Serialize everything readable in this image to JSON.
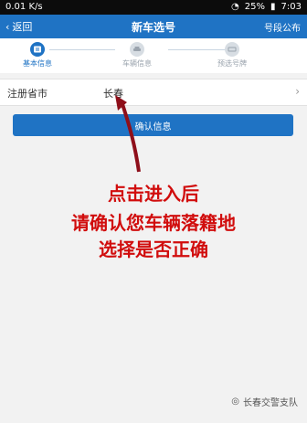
{
  "status_bar": {
    "network_speed": "0.01 K/s",
    "battery": "25%",
    "time": "7:03"
  },
  "header": {
    "back_label": "返回",
    "title": "新车选号",
    "right_label": "号段公布"
  },
  "steps": [
    {
      "label": "基本信息",
      "state": "active"
    },
    {
      "label": "车辆信息",
      "state": "inactive"
    },
    {
      "label": "预选号牌",
      "state": "inactive"
    }
  ],
  "form": {
    "registration_city_label": "注册省市",
    "registration_city_value": "长春"
  },
  "confirm_button": "确认信息",
  "annotation": {
    "line1": "点击进入后",
    "line2": "请确认您车辆落籍地",
    "line3": "选择是否正确"
  },
  "watermark": "长春交警支队",
  "colors": {
    "primary": "#1f73c4",
    "annotation": "#d10d0d"
  }
}
